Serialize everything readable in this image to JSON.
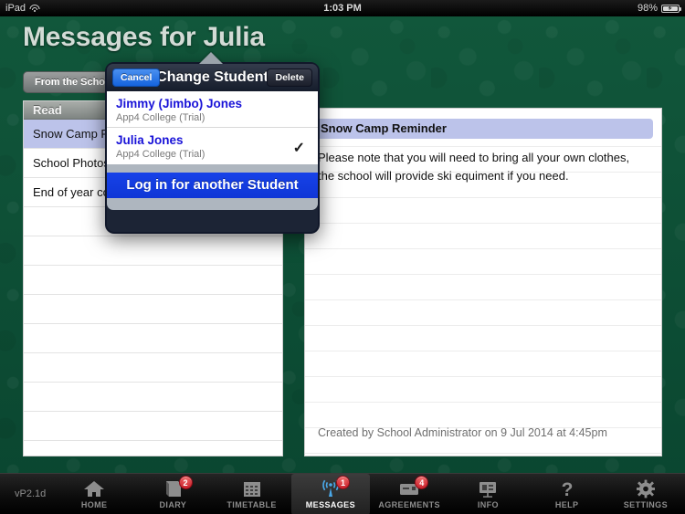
{
  "status_bar": {
    "carrier": "iPad",
    "wifi_icon": "wifi-icon",
    "time": "1:03 PM",
    "battery_percent": "98%",
    "battery_icon": "battery-charging-icon"
  },
  "header": {
    "page_title": "Messages for Julia"
  },
  "segmented_control": {
    "options": [
      "From the School"
    ],
    "selected": "From the School"
  },
  "message_list": {
    "section_header": "Read",
    "rows": [
      {
        "title": "Snow Camp Reminder",
        "selected": true
      },
      {
        "title": "School Photos",
        "selected": false
      },
      {
        "title": "End of year concert",
        "selected": false
      }
    ],
    "empty_row_count": 9
  },
  "detail": {
    "subject": "Snow Camp Reminder",
    "body": "Please note that you will need to bring all your own clothes, the school will provide ski equiment if you need.",
    "created": "Created by School Administrator on 9 Jul 2014 at 4:45pm"
  },
  "popover": {
    "title": "Change Student",
    "cancel_label": "Cancel",
    "delete_label": "Delete",
    "students": [
      {
        "name": "Jimmy (Jimbo) Jones",
        "school": "App4 College (Trial)",
        "checked": ""
      },
      {
        "name": "Julia Jones",
        "school": "App4 College (Trial)",
        "checked": "✓"
      }
    ],
    "login_label": "Log in for another Student"
  },
  "tab_bar": {
    "version": "vP2.1d",
    "tabs": [
      {
        "label": "HOME",
        "icon": "home-icon",
        "badge": "",
        "active": false
      },
      {
        "label": "DIARY",
        "icon": "book-icon",
        "badge": "2",
        "active": false
      },
      {
        "label": "TIMETABLE",
        "icon": "calendar-icon",
        "badge": "",
        "active": false
      },
      {
        "label": "MESSAGES",
        "icon": "broadcast-icon",
        "badge": "1",
        "active": true
      },
      {
        "label": "AGREEMENTS",
        "icon": "card-icon",
        "badge": "4",
        "active": false
      },
      {
        "label": "INFO",
        "icon": "presentation-icon",
        "badge": "",
        "active": false
      },
      {
        "label": "HELP",
        "icon": "question-mark-icon",
        "badge": "",
        "active": false
      },
      {
        "label": "SETTINGS",
        "icon": "gear-icon",
        "badge": "",
        "active": false
      }
    ]
  },
  "colors": {
    "background_green": "#0d4d34",
    "selection_lavender": "#bcc3ea",
    "link_blue": "#1913d8",
    "button_blue": "#1742e8",
    "badge_red": "#c1121f"
  }
}
